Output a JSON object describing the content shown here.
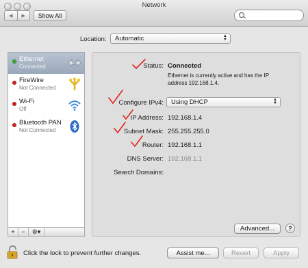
{
  "window": {
    "title": "Network"
  },
  "toolbar": {
    "back_glyph": "◀",
    "forward_glyph": "▶",
    "show_all_label": "Show All",
    "search_placeholder": ""
  },
  "location": {
    "label": "Location:",
    "value": "Automatic"
  },
  "services": [
    {
      "name": "Ethernet",
      "status": "Connected",
      "status_color": "#44b03a",
      "icon": "ethernet-arrows-icon",
      "selected": true
    },
    {
      "name": "FireWire",
      "status": "Not Connected",
      "status_color": "#d9261c",
      "icon": "firewire-icon"
    },
    {
      "name": "Wi-Fi",
      "status": "Off",
      "status_color": "#d9261c",
      "icon": "wifi-icon"
    },
    {
      "name": "Bluetooth PAN",
      "status": "Not Connected",
      "status_color": "#d9261c",
      "icon": "bluetooth-icon"
    }
  ],
  "sidebar_buttons": {
    "add": "+",
    "remove": "−",
    "gear": "⚙▾"
  },
  "details": {
    "status_label": "Status:",
    "status_value": "Connected",
    "status_desc": "Ethernet is currently active and has the IP address 192.168.1.4.",
    "configure_label": "Configure IPv4:",
    "configure_value": "Using DHCP",
    "ip_label": "IP Address:",
    "ip_value": "192.168.1.4",
    "subnet_label": "Subnet Mask:",
    "subnet_value": "255.255.255.0",
    "router_label": "Router:",
    "router_value": "192.168.1.1",
    "dns_label": "DNS Server:",
    "dns_value": "192.168.1.1",
    "search_domains_label": "Search Domains:",
    "advanced_label": "Advanced...",
    "help_label": "?"
  },
  "footer": {
    "lock_text": "Click the lock to prevent further changes.",
    "assist_label": "Assist me...",
    "revert_label": "Revert",
    "apply_label": "Apply"
  },
  "colors": {
    "checkmark": "#e0231c",
    "selection": "#a3b0c2"
  }
}
